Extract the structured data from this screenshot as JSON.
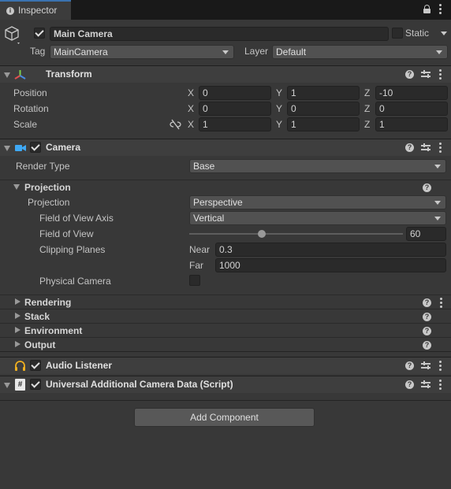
{
  "tab": {
    "label": "Inspector"
  },
  "object": {
    "name": "Main Camera",
    "static_label": "Static",
    "tag_label": "Tag",
    "tag_value": "MainCamera",
    "layer_label": "Layer",
    "layer_value": "Default"
  },
  "transform": {
    "title": "Transform",
    "position": {
      "label": "Position",
      "x": "0",
      "y": "1",
      "z": "-10"
    },
    "rotation": {
      "label": "Rotation",
      "x": "0",
      "y": "0",
      "z": "0"
    },
    "scale": {
      "label": "Scale",
      "x": "1",
      "y": "1",
      "z": "1"
    },
    "axis": {
      "x": "X",
      "y": "Y",
      "z": "Z"
    }
  },
  "camera": {
    "title": "Camera",
    "render_type_label": "Render Type",
    "render_type_value": "Base",
    "projection_section": "Projection",
    "projection_label": "Projection",
    "projection_value": "Perspective",
    "fov_axis_label": "Field of View Axis",
    "fov_axis_value": "Vertical",
    "fov_label": "Field of View",
    "fov_value": "60",
    "fov_fraction": 0.34,
    "clipping_label": "Clipping Planes",
    "near_label": "Near",
    "near_value": "0.3",
    "far_label": "Far",
    "far_value": "1000",
    "physical_label": "Physical Camera",
    "sections": [
      "Rendering",
      "Stack",
      "Environment",
      "Output"
    ]
  },
  "audio_listener": {
    "title": "Audio Listener"
  },
  "camera_data": {
    "title": "Universal Additional Camera Data (Script)"
  },
  "add_component": "Add Component",
  "colors": {
    "accent": "#3a72b0",
    "background": "#383838",
    "header": "#3e3e3e"
  }
}
